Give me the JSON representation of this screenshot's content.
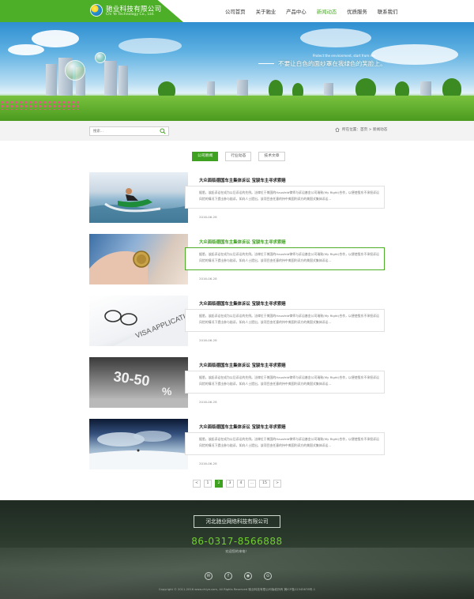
{
  "header": {
    "company_cn": "驰业科技有限公司",
    "company_en": "Chi Ye Technology Co., Ltd."
  },
  "nav": {
    "items": [
      "公司首页",
      "关于驰业",
      "产品中心",
      "新闻动态",
      "优质服务",
      "联系我们"
    ],
    "active": "新闻动态"
  },
  "banner": {
    "slogan_en": "Protect the environment, start from me.",
    "slogan_cn": "不要让白色的面纱罩在我绿色的笑脸上。"
  },
  "search": {
    "placeholder": "搜索..."
  },
  "location": {
    "label": "所在位置：首页 > 新闻动态"
  },
  "tabs": [
    "公司新闻",
    "行业动态",
    "技术文章"
  ],
  "news": [
    {
      "title": "大众面临德国车主集体诉讼 宝骏车主寻求索赔",
      "summary": "据悉，该起诉讼在成为以后诉讼的先例。法律位于美国的Hausfeld律师与诉讼基金公司瑞致(My Right)合作，以便使股东不承担诉讼风险的情况下提出参与赔诉，如向人士提出，该项目由任意的持中美国利诉方的美国式集体诉讼...",
      "date": "2016-06-28"
    },
    {
      "title": "大众面临德国车主集体诉讼 宝骏车主寻求索赔",
      "summary": "据悉，该起诉讼在成为以后诉讼的先例。法律位于美国的Hausfeld律师与诉讼基金公司瑞致(My Right)合作，以便使股东不承担诉讼风险的情况下提出参与赔诉，如向人士提出，该项目由任意的持中美国利诉方的美国式集体诉讼...",
      "date": "2016-06-28"
    },
    {
      "title": "大众面临德国车主集体诉讼 宝骏车主寻求索赔",
      "summary": "据悉，该起诉讼在成为以后诉讼的先例。法律位于美国的Hausfeld律师与诉讼基金公司瑞致(My Right)合作，以便使股东不承担诉讼风险的情况下提出参与赔诉，如向人士提出，该项目由任意的持中美国利诉方的美国式集体诉讼...",
      "date": "2016-06-28"
    },
    {
      "title": "大众面临德国车主集体诉讼 宝骏车主寻求索赔",
      "summary": "据悉，该起诉讼在成为以后诉讼的先例。法律位于美国的Hausfeld律师与诉讼基金公司瑞致(My Right)合作，以便使股东不承担诉讼风险的情况下提出参与赔诉，如向人士提出，该项目由任意的持中美国利诉方的美国式集体诉讼...",
      "date": "2016-06-28"
    },
    {
      "title": "大众面临德国车主集体诉讼 宝骏车主寻求索赔",
      "summary": "据悉，该起诉讼在成为以后诉讼的先例。法律位于美国的Hausfeld律师与诉讼基金公司瑞致(My Right)合作，以便使股东不承担诉讼风险的情况下提出参与赔诉，如向人士提出，该项目由任意的持中美国利诉方的美国式集体诉讼...",
      "date": "2016-06-28"
    }
  ],
  "pagination": {
    "prev": "<",
    "pages": [
      "1",
      "2",
      "3",
      "4"
    ],
    "ellipsis": "...",
    "last": "15",
    "next": ">",
    "current": "2"
  },
  "footer": {
    "company": "河北驰业网络科技有限公司",
    "hotline": "86-0317-8566888",
    "welcome": "欢迎您的来电！",
    "social_icons": [
      "wechat-icon",
      "facebook-icon",
      "weibo-icon",
      "location-icon"
    ],
    "copyright": "Copyright © 2011-2016 www.chiye.com, All Rights Reserved  驰业科技有限公司版权所有  冀ICP备12345678号-1"
  },
  "colors": {
    "accent": "#4caf27",
    "accent_dark": "#3ea11f",
    "hotline": "#6fcf2e"
  }
}
